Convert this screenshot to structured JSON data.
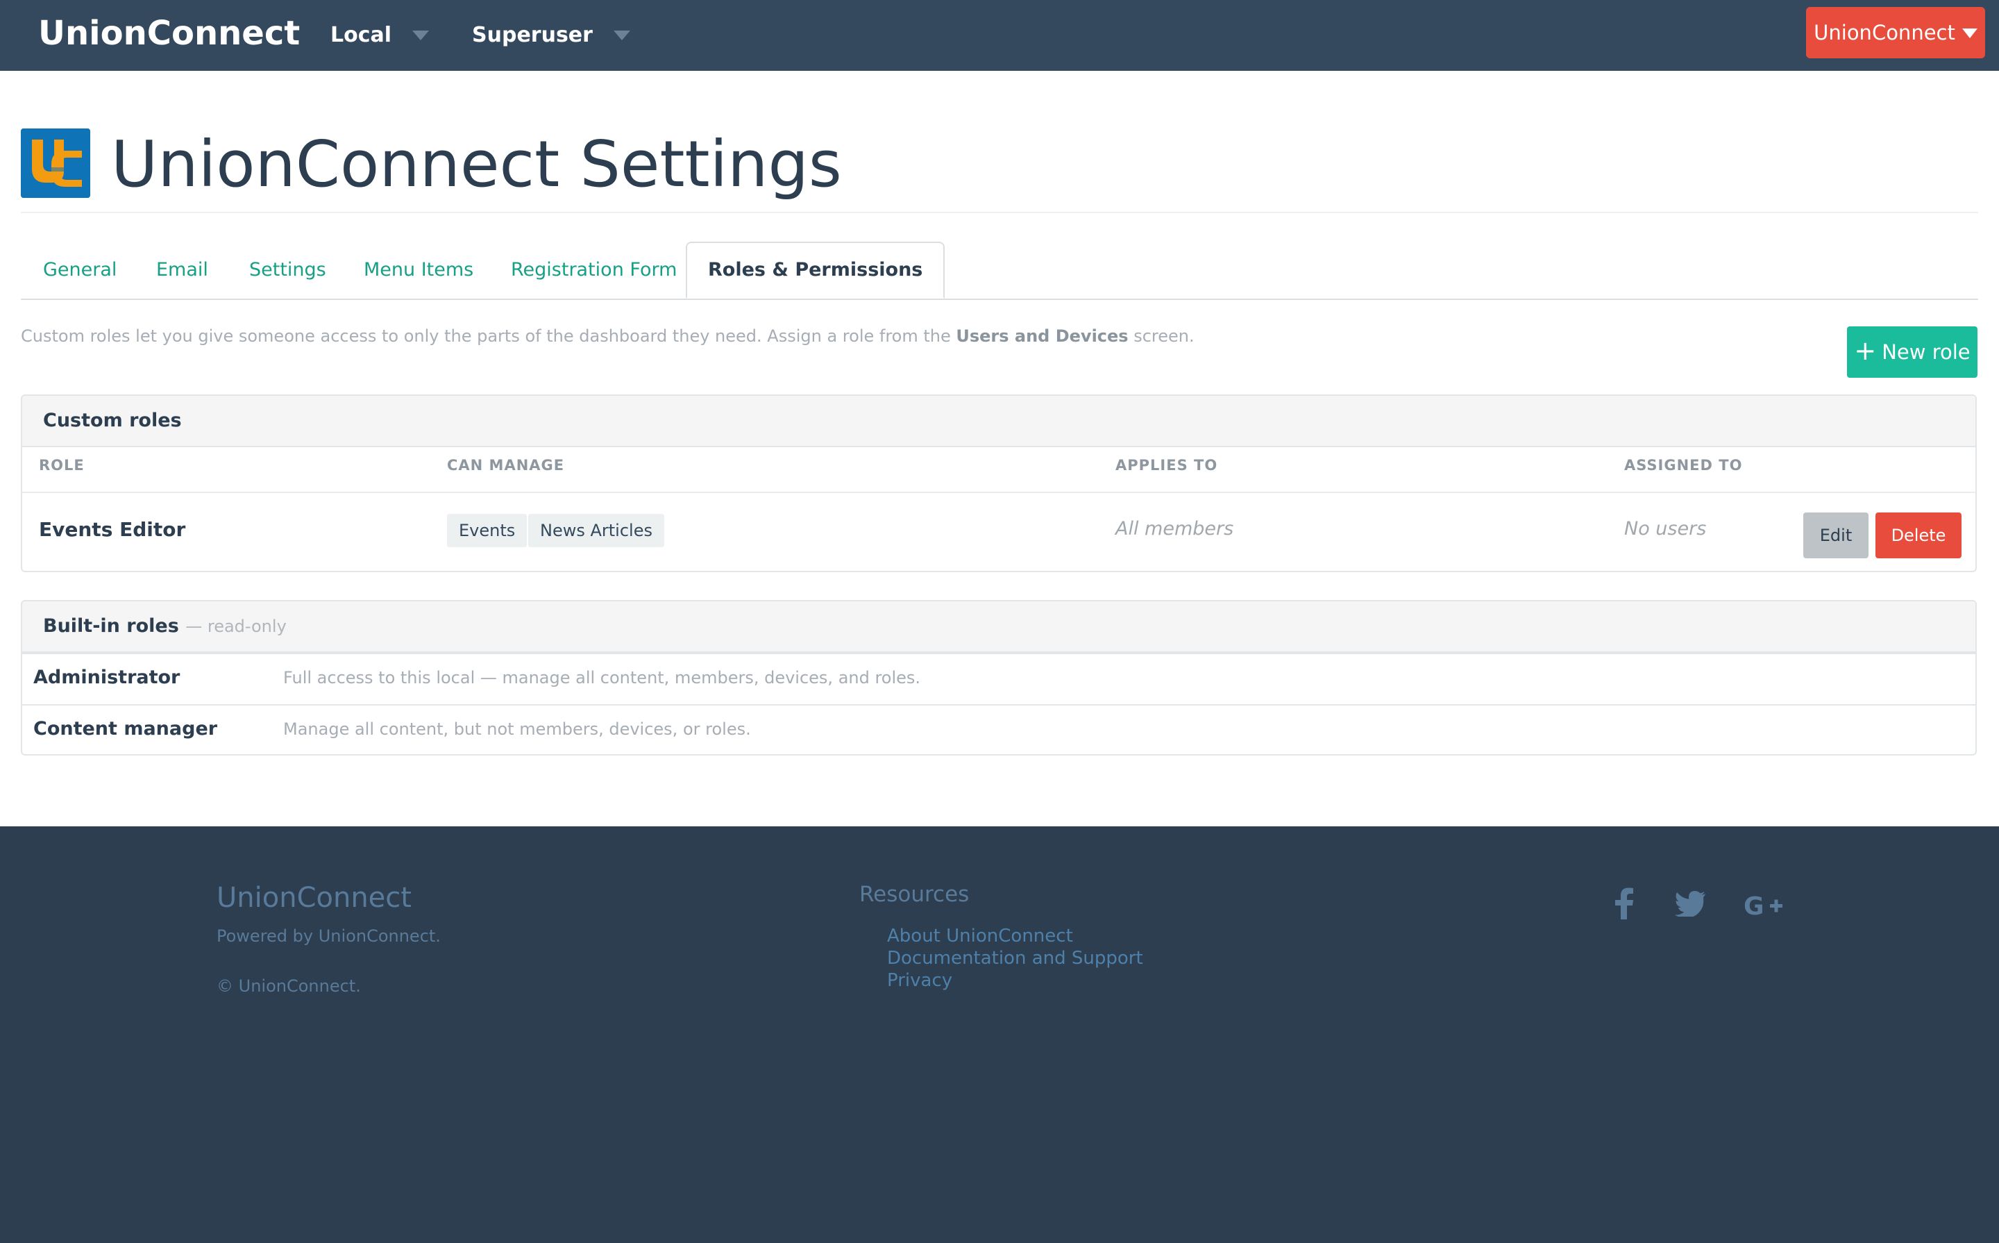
{
  "navbar": {
    "brand": "UnionConnect",
    "local_label": "Local",
    "user_label": "Superuser",
    "account_label": "UnionConnect"
  },
  "header": {
    "title": "UnionConnect Settings",
    "logo_text": "UC"
  },
  "tabs": [
    {
      "label": "General",
      "active": false
    },
    {
      "label": "Email",
      "active": false
    },
    {
      "label": "Settings",
      "active": false
    },
    {
      "label": "Menu Items",
      "active": false
    },
    {
      "label": "Registration Form",
      "active": false
    },
    {
      "label": "Roles & Permissions",
      "active": true
    }
  ],
  "intro": {
    "text_before": "Custom roles let you give someone access to only the parts of the dashboard they need. Assign a role from the ",
    "link_text": "Users and Devices",
    "text_after": " screen.",
    "new_role_label": "New role"
  },
  "custom_roles": {
    "title": "Custom roles",
    "columns": [
      "ROLE",
      "CAN MANAGE",
      "APPLIES TO",
      "ASSIGNED TO"
    ],
    "rows": [
      {
        "role": "Events Editor",
        "can_manage": [
          "Events",
          "News Articles"
        ],
        "applies_to": "All members",
        "assigned_to": "No users",
        "edit_label": "Edit",
        "delete_label": "Delete"
      }
    ]
  },
  "builtin_roles": {
    "title": "Built-in roles",
    "subtitle": "— read-only",
    "rows": [
      {
        "name": "Administrator",
        "description": "Full access to this local — manage all content, members, devices, and roles."
      },
      {
        "name": "Content manager",
        "description": "Manage all content, but not members, devices, or roles."
      }
    ]
  },
  "footer": {
    "brand": "UnionConnect",
    "powered": "Powered by UnionConnect.",
    "copyright": "© UnionConnect.",
    "resources_title": "Resources",
    "links": [
      "About UnionConnect",
      "Documentation and Support",
      "Privacy"
    ],
    "social": [
      "facebook-icon",
      "twitter-icon",
      "google-plus-icon"
    ]
  },
  "colors": {
    "navbar": "#34495e",
    "footer": "#2c3e50",
    "accent_green": "#1abc9c",
    "danger": "#e74c3c",
    "tab_link": "#16a085"
  }
}
